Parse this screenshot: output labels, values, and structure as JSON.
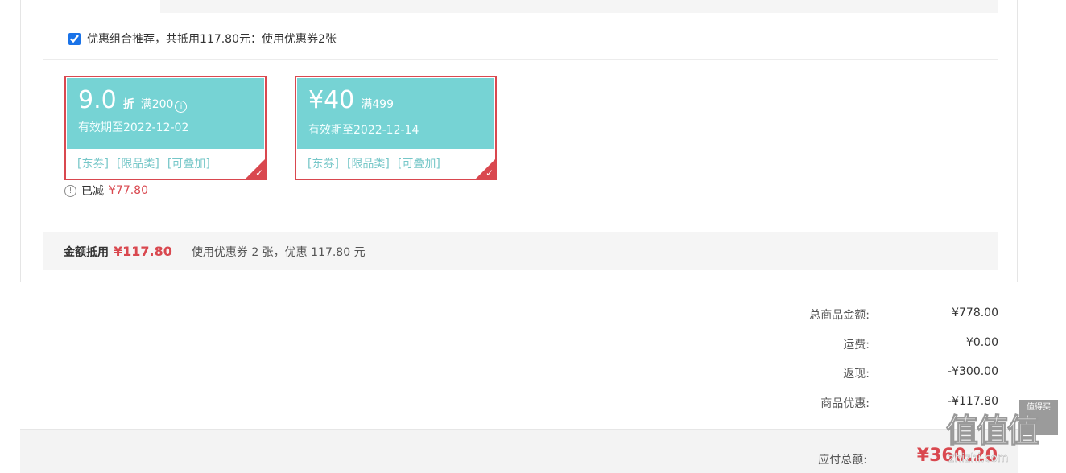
{
  "combo": {
    "checked": true,
    "label": "优惠组合推荐，共抵用117.80元：使用优惠券2张"
  },
  "coupons": [
    {
      "amount": "9.0",
      "unit": "折",
      "condition": "满200",
      "valid_until": "有效期至2022-12-02",
      "tags": [
        "[东券]",
        "[限品类]",
        "[可叠加]"
      ],
      "selected": true
    },
    {
      "amount": "¥40",
      "unit": "",
      "condition": "满499",
      "valid_until": "有效期至2022-12-14",
      "tags": [
        "[东券]",
        "[限品类]",
        "[可叠加]"
      ],
      "selected": true
    }
  ],
  "reduced": {
    "label": "已减",
    "value": "¥77.80"
  },
  "summary": {
    "label": "金额抵用",
    "amount": "¥117.80",
    "desc": "使用优惠券 2 张，优惠 117.80 元"
  },
  "totals": [
    {
      "label": "总商品金额:",
      "value": "¥778.00"
    },
    {
      "label": "运费:",
      "value": "¥0.00"
    },
    {
      "label": "返现:",
      "value": "-¥300.00"
    },
    {
      "label": "商品优惠:",
      "value": "-¥117.80"
    }
  ],
  "payable": {
    "label": "应付总额:",
    "value": "¥360.20"
  },
  "watermark": {
    "text": "值值值",
    "url": "zhizhi.com",
    "box": "值得买"
  },
  "colors": {
    "coupon_bg": "#76d3d4",
    "accent_red": "#d9484f",
    "tag_teal": "#76c7c8"
  }
}
